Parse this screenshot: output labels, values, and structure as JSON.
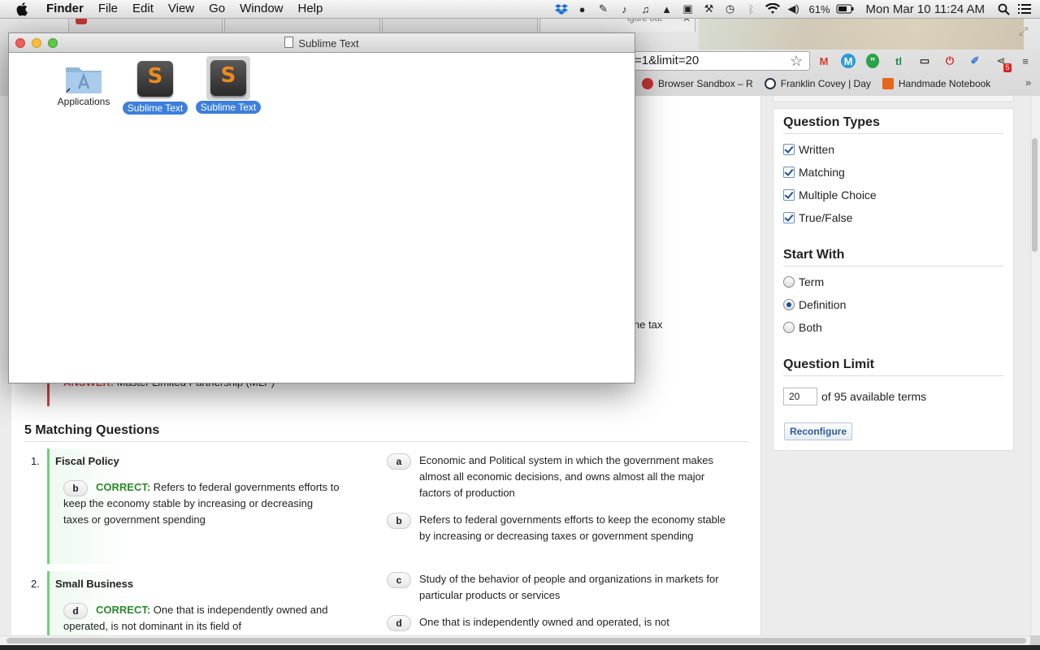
{
  "menubar": {
    "app_name": "Finder",
    "items": [
      "File",
      "Edit",
      "View",
      "Go",
      "Window",
      "Help"
    ],
    "battery": "61%",
    "datetime": "Mon Mar 10  11:24 AM"
  },
  "browser": {
    "tab_title_partial": "igure out",
    "url_partial": "=1&limit=20",
    "extension_badge": "5",
    "bookmarks": [
      "Browser Sandbox – R",
      "Franklin Covey | Day",
      "Handmade Notebook"
    ]
  },
  "finder": {
    "title": "Sublime Text",
    "items": [
      {
        "label": "Applications",
        "selected": false
      },
      {
        "label": "Sublime Text",
        "selected": true
      },
      {
        "label": "Sublime Text",
        "selected": true
      }
    ]
  },
  "sidebar": {
    "question_types_heading": "Question Types",
    "question_types": [
      "Written",
      "Matching",
      "Multiple Choice",
      "True/False"
    ],
    "start_with_heading": "Start With",
    "start_with": [
      {
        "label": "Term",
        "selected": false
      },
      {
        "label": "Definition",
        "selected": true
      },
      {
        "label": "Both",
        "selected": false
      }
    ],
    "limit_heading": "Question Limit",
    "limit_value": "20",
    "limit_text": "of 95 available terms",
    "reconfigure_label": "Reconfigure"
  },
  "main": {
    "answer_label": "ANSWER:",
    "answer_text": "Master Limited Partnership (MLP)",
    "tax_fragment": "ne tax",
    "section_title": "5 Matching Questions",
    "correct_label": "CORRECT:",
    "questions": [
      {
        "num": "1.",
        "term": "Fiscal Policy",
        "letter": "b",
        "answer": "Refers to federal governments efforts to keep the economy stable by increasing or decreasing taxes or government spending"
      },
      {
        "num": "2.",
        "term": "Small Business",
        "letter": "d",
        "answer": "One that is independently owned and operated, is not dominant in its field of"
      }
    ],
    "matches": [
      {
        "letter": "a",
        "text": "Economic and Political system in which the government makes almost all economic decisions, and owns almost all the major factors of production"
      },
      {
        "letter": "b",
        "text": "Refers to federal governments efforts to keep the economy stable by increasing or decreasing taxes or government spending"
      },
      {
        "letter": "c",
        "text": "Study of the behavior of people and organizations in markets for particular products or services"
      },
      {
        "letter": "d",
        "text": "One that is independently owned and operated, is not"
      }
    ]
  }
}
